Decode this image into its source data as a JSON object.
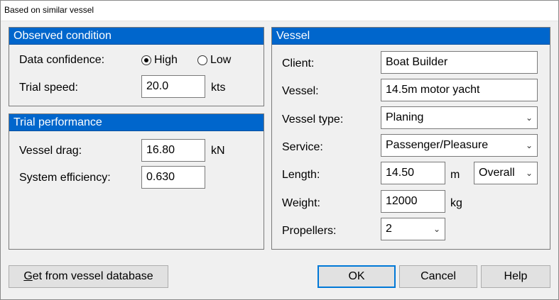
{
  "window": {
    "title": "Based on similar vessel"
  },
  "observed": {
    "title": "Observed condition",
    "confidence_label": "Data confidence:",
    "confidence_options": [
      "High",
      "Low"
    ],
    "confidence_selected": "High",
    "speed_label": "Trial speed:",
    "speed_value": "20.0",
    "speed_unit": "kts"
  },
  "trial": {
    "title": "Trial performance",
    "drag_label": "Vessel drag:",
    "drag_value": "16.80",
    "drag_unit": "kN",
    "efficiency_label": "System efficiency:",
    "efficiency_value": "0.630"
  },
  "vessel": {
    "title": "Vessel",
    "client_label": "Client:",
    "client_value": "Boat Builder",
    "vessel_label": "Vessel:",
    "vessel_value": "14.5m motor yacht",
    "type_label": "Vessel type:",
    "type_value": "Planing",
    "service_label": "Service:",
    "service_value": "Passenger/Pleasure",
    "length_label": "Length:",
    "length_value": "14.50",
    "length_unit": "m",
    "length_type": "Overall",
    "weight_label": "Weight:",
    "weight_value": "12000",
    "weight_unit": "kg",
    "propellers_label": "Propellers:",
    "propellers_value": "2"
  },
  "buttons": {
    "database_first_letter": "G",
    "database_rest": "et from vessel database",
    "ok": "OK",
    "cancel": "Cancel",
    "help": "Help"
  },
  "icons": {
    "dropdown": "chevron-down-icon",
    "radio": "radio-button-icon"
  }
}
